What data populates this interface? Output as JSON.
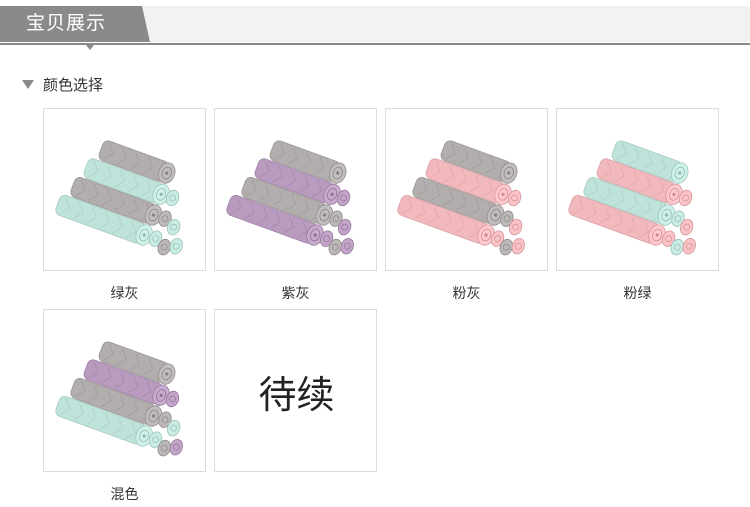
{
  "header": {
    "title": "宝贝展示"
  },
  "section": {
    "title": "颜色选择"
  },
  "colors": {
    "header_gray": "#8a8a8a",
    "green": "#bfe3da",
    "gray": "#b3aeae",
    "purple": "#b89bbf",
    "pink": "#f2b9bd"
  },
  "products": [
    {
      "label": "绿灰",
      "towels": [
        "gray",
        "green",
        "gray",
        "green"
      ],
      "image": "green-gray-towels"
    },
    {
      "label": "紫灰",
      "towels": [
        "gray",
        "purple",
        "gray",
        "purple"
      ],
      "image": "purple-gray-towels"
    },
    {
      "label": "粉灰",
      "towels": [
        "gray",
        "pink",
        "gray",
        "pink"
      ],
      "image": "pink-gray-towels"
    },
    {
      "label": "粉绿",
      "towels": [
        "green",
        "pink",
        "green",
        "pink"
      ],
      "image": "pink-green-towels"
    },
    {
      "label": "混色",
      "towels": [
        "gray",
        "purple",
        "gray",
        "green"
      ],
      "image": "mixed-towels"
    },
    {
      "label": "",
      "placeholder": "待续"
    }
  ]
}
